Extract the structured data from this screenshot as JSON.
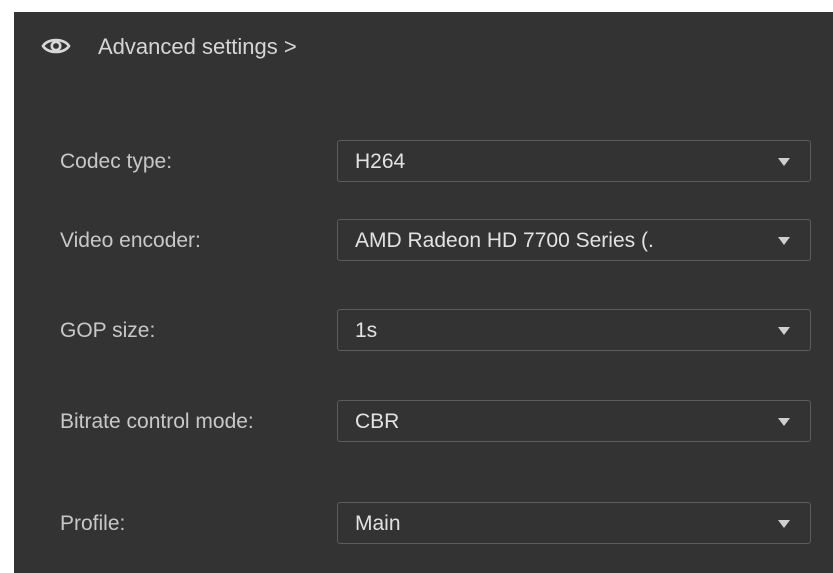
{
  "header": {
    "icon": "eye-icon",
    "title": "Advanced settings >"
  },
  "fields": [
    {
      "label": "Codec type:",
      "value": "H264"
    },
    {
      "label": "Video encoder:",
      "value": "AMD Radeon HD 7700 Series (."
    },
    {
      "label": "GOP size:",
      "value": "1s"
    },
    {
      "label": "Bitrate control mode:",
      "value": "CBR"
    },
    {
      "label": "Profile:",
      "value": "Main"
    }
  ],
  "colors": {
    "panel_background": "#333333",
    "select_border": "#5c5c5c",
    "text": "#d3d3d3"
  }
}
